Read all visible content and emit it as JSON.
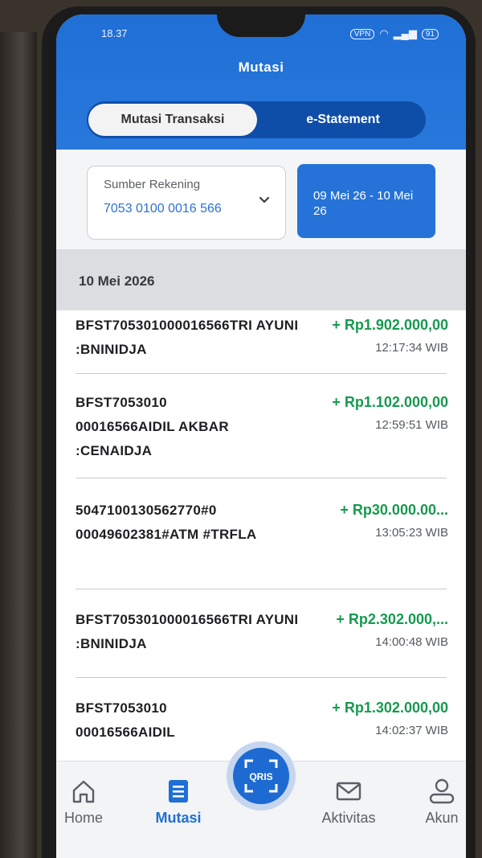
{
  "status_bar": {
    "time": "18.37",
    "vpn": "VPN",
    "battery": "91"
  },
  "header": {
    "title": "Mutasi"
  },
  "tabs": [
    {
      "label": "Mutasi Transaksi",
      "active": true
    },
    {
      "label": "e-Statement",
      "active": false
    }
  ],
  "filter": {
    "source_label": "Sumber Rekening",
    "account_number": "7053 0100 0016 566",
    "date_range": "09 Mei 26 - 10 Mei 26"
  },
  "date_group": "10 Mei 2026",
  "transactions": [
    {
      "desc": "BFST705301000016566TRI AYUNI   :BNINIDJA",
      "amount": "+ Rp1.902.000,00",
      "time": "12:17:34 WIB"
    },
    {
      "desc": "BFST7053010 00016566AIDIL AKBAR :CENAIDJA",
      "amount": "+ Rp1.102.000,00",
      "time": "12:59:51 WIB"
    },
    {
      "desc": "5047100130562770#0 00049602381#ATM #TRFLA",
      "amount": "+ Rp30.000.00...",
      "time": "13:05:23 WIB"
    },
    {
      "desc": "BFST705301000016566TRI AYUNI   :BNINIDJA",
      "amount": "+ Rp2.302.000,...",
      "time": "14:00:48 WIB"
    },
    {
      "desc": "BFST7053010 00016566AIDIL",
      "amount": "+ Rp1.302.000,00",
      "time": "14:02:37 WIB"
    }
  ],
  "bottom_nav": [
    {
      "label": "Home",
      "icon": "home-icon",
      "active": false
    },
    {
      "label": "Mutasi",
      "icon": "receipt-icon",
      "active": true
    },
    {
      "label": "Aktivitas",
      "icon": "mail-icon",
      "active": false
    },
    {
      "label": "Akun",
      "icon": "user-icon",
      "active": false
    }
  ],
  "qris_label": "QRIS",
  "colors": {
    "primary": "#1f6fd6",
    "amount_green": "#169a4f",
    "tab_bg": "#0f4ea8"
  }
}
